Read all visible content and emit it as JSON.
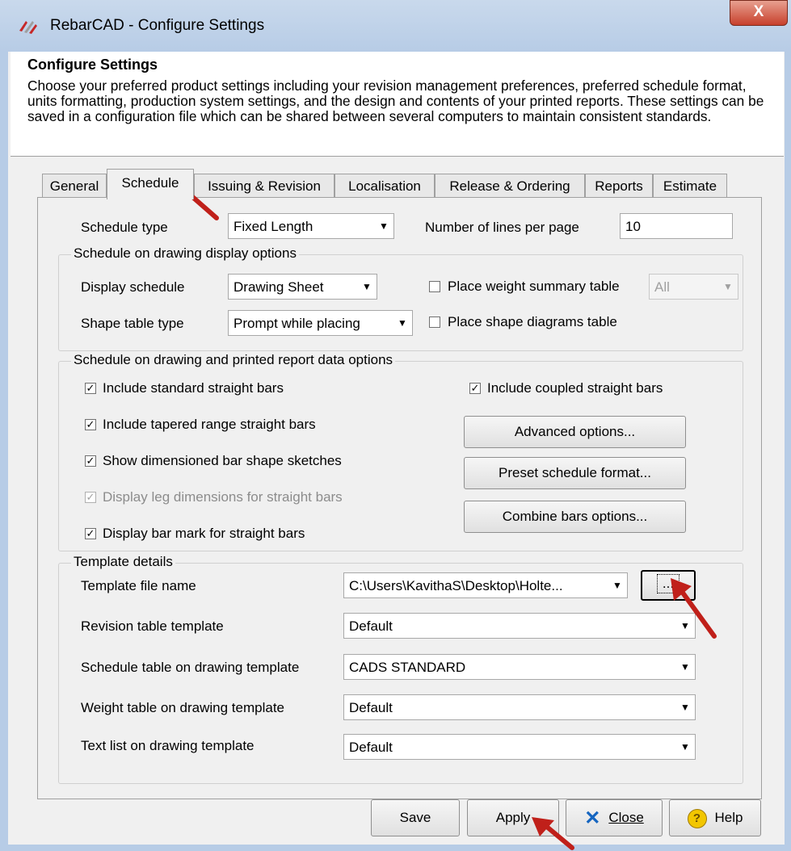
{
  "window": {
    "title": "RebarCAD - Configure Settings",
    "close_label": "X"
  },
  "header": {
    "title": "Configure Settings",
    "description": "Choose your preferred product settings including your revision management preferences, preferred schedule format, units formatting, production system settings, and the design and contents of your printed reports. These settings can be saved in a configuration file which can be shared between several computers to maintain consistent standards."
  },
  "tabs": [
    {
      "label": "General"
    },
    {
      "label": "Schedule"
    },
    {
      "label": "Issuing & Revision"
    },
    {
      "label": "Localisation"
    },
    {
      "label": "Release & Ordering"
    },
    {
      "label": "Reports"
    },
    {
      "label": "Estimate"
    }
  ],
  "active_tab": "Schedule",
  "schedule": {
    "schedule_type_label": "Schedule type",
    "schedule_type_value": "Fixed Length",
    "lines_per_page_label": "Number of lines per page",
    "lines_per_page_value": "10",
    "display_group": {
      "title": "Schedule on drawing display options",
      "display_schedule_label": "Display schedule",
      "display_schedule_value": "Drawing Sheet",
      "shape_table_type_label": "Shape table type",
      "shape_table_type_value": "Prompt while placing",
      "weight_summary_label": "Place weight summary table",
      "weight_summary_checked": false,
      "weight_summary_value": "All",
      "shape_diagrams_label": "Place shape diagrams table",
      "shape_diagrams_checked": false
    },
    "data_group": {
      "title": "Schedule on drawing and printed report data options",
      "options": [
        {
          "label": "Include standard straight bars",
          "checked": true,
          "enabled": true
        },
        {
          "label": "Include tapered range straight bars",
          "checked": true,
          "enabled": true
        },
        {
          "label": "Show dimensioned bar shape sketches",
          "checked": true,
          "enabled": true
        },
        {
          "label": "Display leg dimensions for straight bars",
          "checked": true,
          "enabled": false
        },
        {
          "label": "Display bar mark for straight bars",
          "checked": true,
          "enabled": true
        }
      ],
      "coupled_label": "Include coupled straight bars",
      "coupled_checked": true,
      "advanced_button": "Advanced options...",
      "preset_button": "Preset schedule format...",
      "combine_button": "Combine bars options..."
    },
    "template_group": {
      "title": "Template details",
      "rows": [
        {
          "label": "Template file name",
          "value": "C:\\Users\\KavithaS\\Desktop\\Holte..."
        },
        {
          "label": "Revision table template",
          "value": "Default"
        },
        {
          "label": "Schedule table on drawing template",
          "value": "CADS STANDARD"
        },
        {
          "label": "Weight table on drawing template",
          "value": "Default"
        },
        {
          "label": "Text list on drawing template",
          "value": "Default"
        }
      ],
      "browse_label": "..."
    }
  },
  "footer": {
    "save_label": "Save",
    "apply_label": "Apply",
    "close_label": "Close",
    "help_label": "Help"
  },
  "colors": {
    "title_bar": "#b7cce6",
    "close_button": "#c7402c",
    "annotation_arrow": "#c0201a",
    "panel_bg": "#f0f0f0"
  }
}
